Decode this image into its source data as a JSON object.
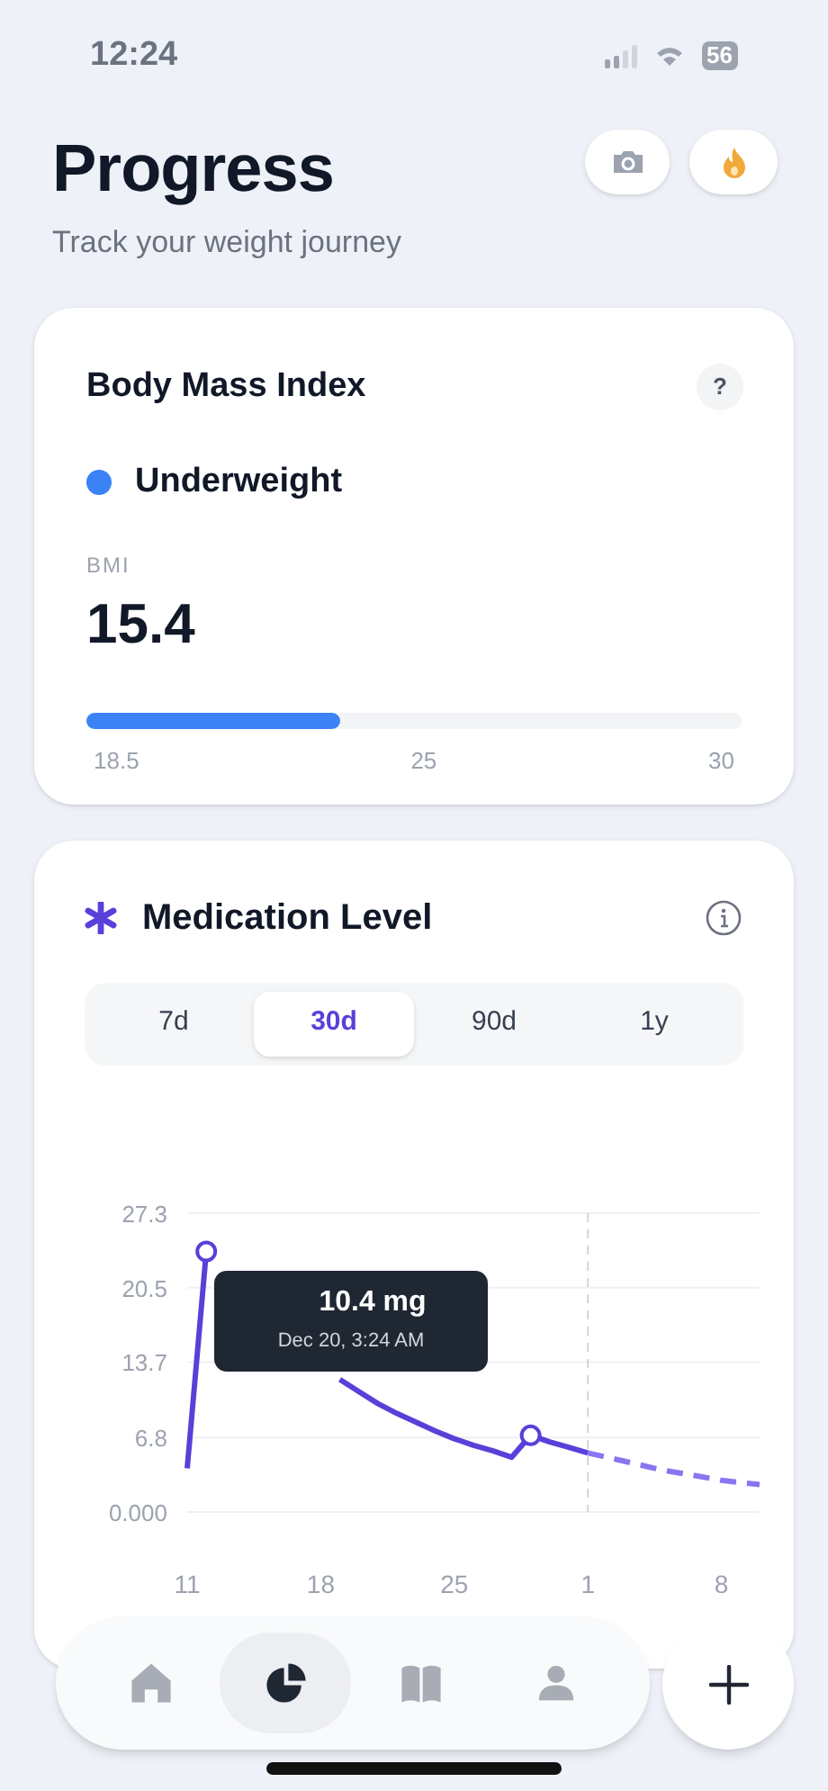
{
  "status_bar": {
    "time": "12:24",
    "battery": "56"
  },
  "header": {
    "title": "Progress",
    "subtitle": "Track your weight journey"
  },
  "bmi_card": {
    "title": "Body Mass Index",
    "help": "?",
    "category": "Underweight",
    "label": "BMI",
    "value": "15.4",
    "level": 0.386,
    "scale_labels": [
      "18.5",
      "25",
      "30"
    ]
  },
  "medication_card": {
    "title": "Medication Level",
    "tabs": [
      {
        "label": "7d",
        "selected": false
      },
      {
        "label": "30d",
        "selected": true
      },
      {
        "label": "90d",
        "selected": false
      },
      {
        "label": "1y",
        "selected": false
      }
    ],
    "tooltip": {
      "value": "10.4 mg",
      "date": "Dec 20, 3:24 AM"
    },
    "chart_data": {
      "type": "line",
      "categories": [
        "11",
        null,
        null,
        null,
        null,
        null,
        null,
        "18",
        null,
        null,
        null,
        null,
        null,
        null,
        "25",
        null,
        null,
        null,
        null,
        null,
        null,
        "1",
        null,
        null,
        null,
        null,
        null,
        null,
        "8",
        null,
        null
      ],
      "yticks": [
        {
          "value": 0,
          "label": "0.000"
        },
        {
          "value": 6.8,
          "label": "6.8"
        },
        {
          "value": 13.7,
          "label": "13.7"
        },
        {
          "value": 20.5,
          "label": "20.5"
        },
        {
          "value": 27.3,
          "label": "27.3"
        }
      ],
      "ylim": [
        0,
        27.3
      ],
      "grid": true,
      "series": [
        {
          "color": "#5b3fd9",
          "values": [
            4.0,
            23.8,
            null,
            null,
            null,
            null,
            null,
            null,
            12.1,
            11.0,
            9.9,
            9.0,
            8.2,
            7.4,
            6.7,
            6.1,
            5.6,
            5.0,
            7.0,
            6.4,
            5.9,
            5.4,
            null,
            null,
            null,
            null,
            null,
            null,
            null,
            null,
            null
          ]
        },
        {
          "color": "#8b74f0",
          "line_style": "dashed",
          "values": [
            null,
            null,
            null,
            null,
            null,
            null,
            null,
            null,
            null,
            null,
            null,
            null,
            null,
            null,
            null,
            null,
            null,
            null,
            null,
            null,
            null,
            5.4,
            5.0,
            4.6,
            4.2,
            3.8,
            3.5,
            3.2,
            2.9,
            2.7,
            2.5
          ]
        }
      ]
    }
  },
  "nav": [
    {
      "kind": "home",
      "selected": false
    },
    {
      "kind": "chart",
      "selected": true
    },
    {
      "kind": "book",
      "selected": false
    },
    {
      "kind": "profile",
      "selected": false
    }
  ]
}
